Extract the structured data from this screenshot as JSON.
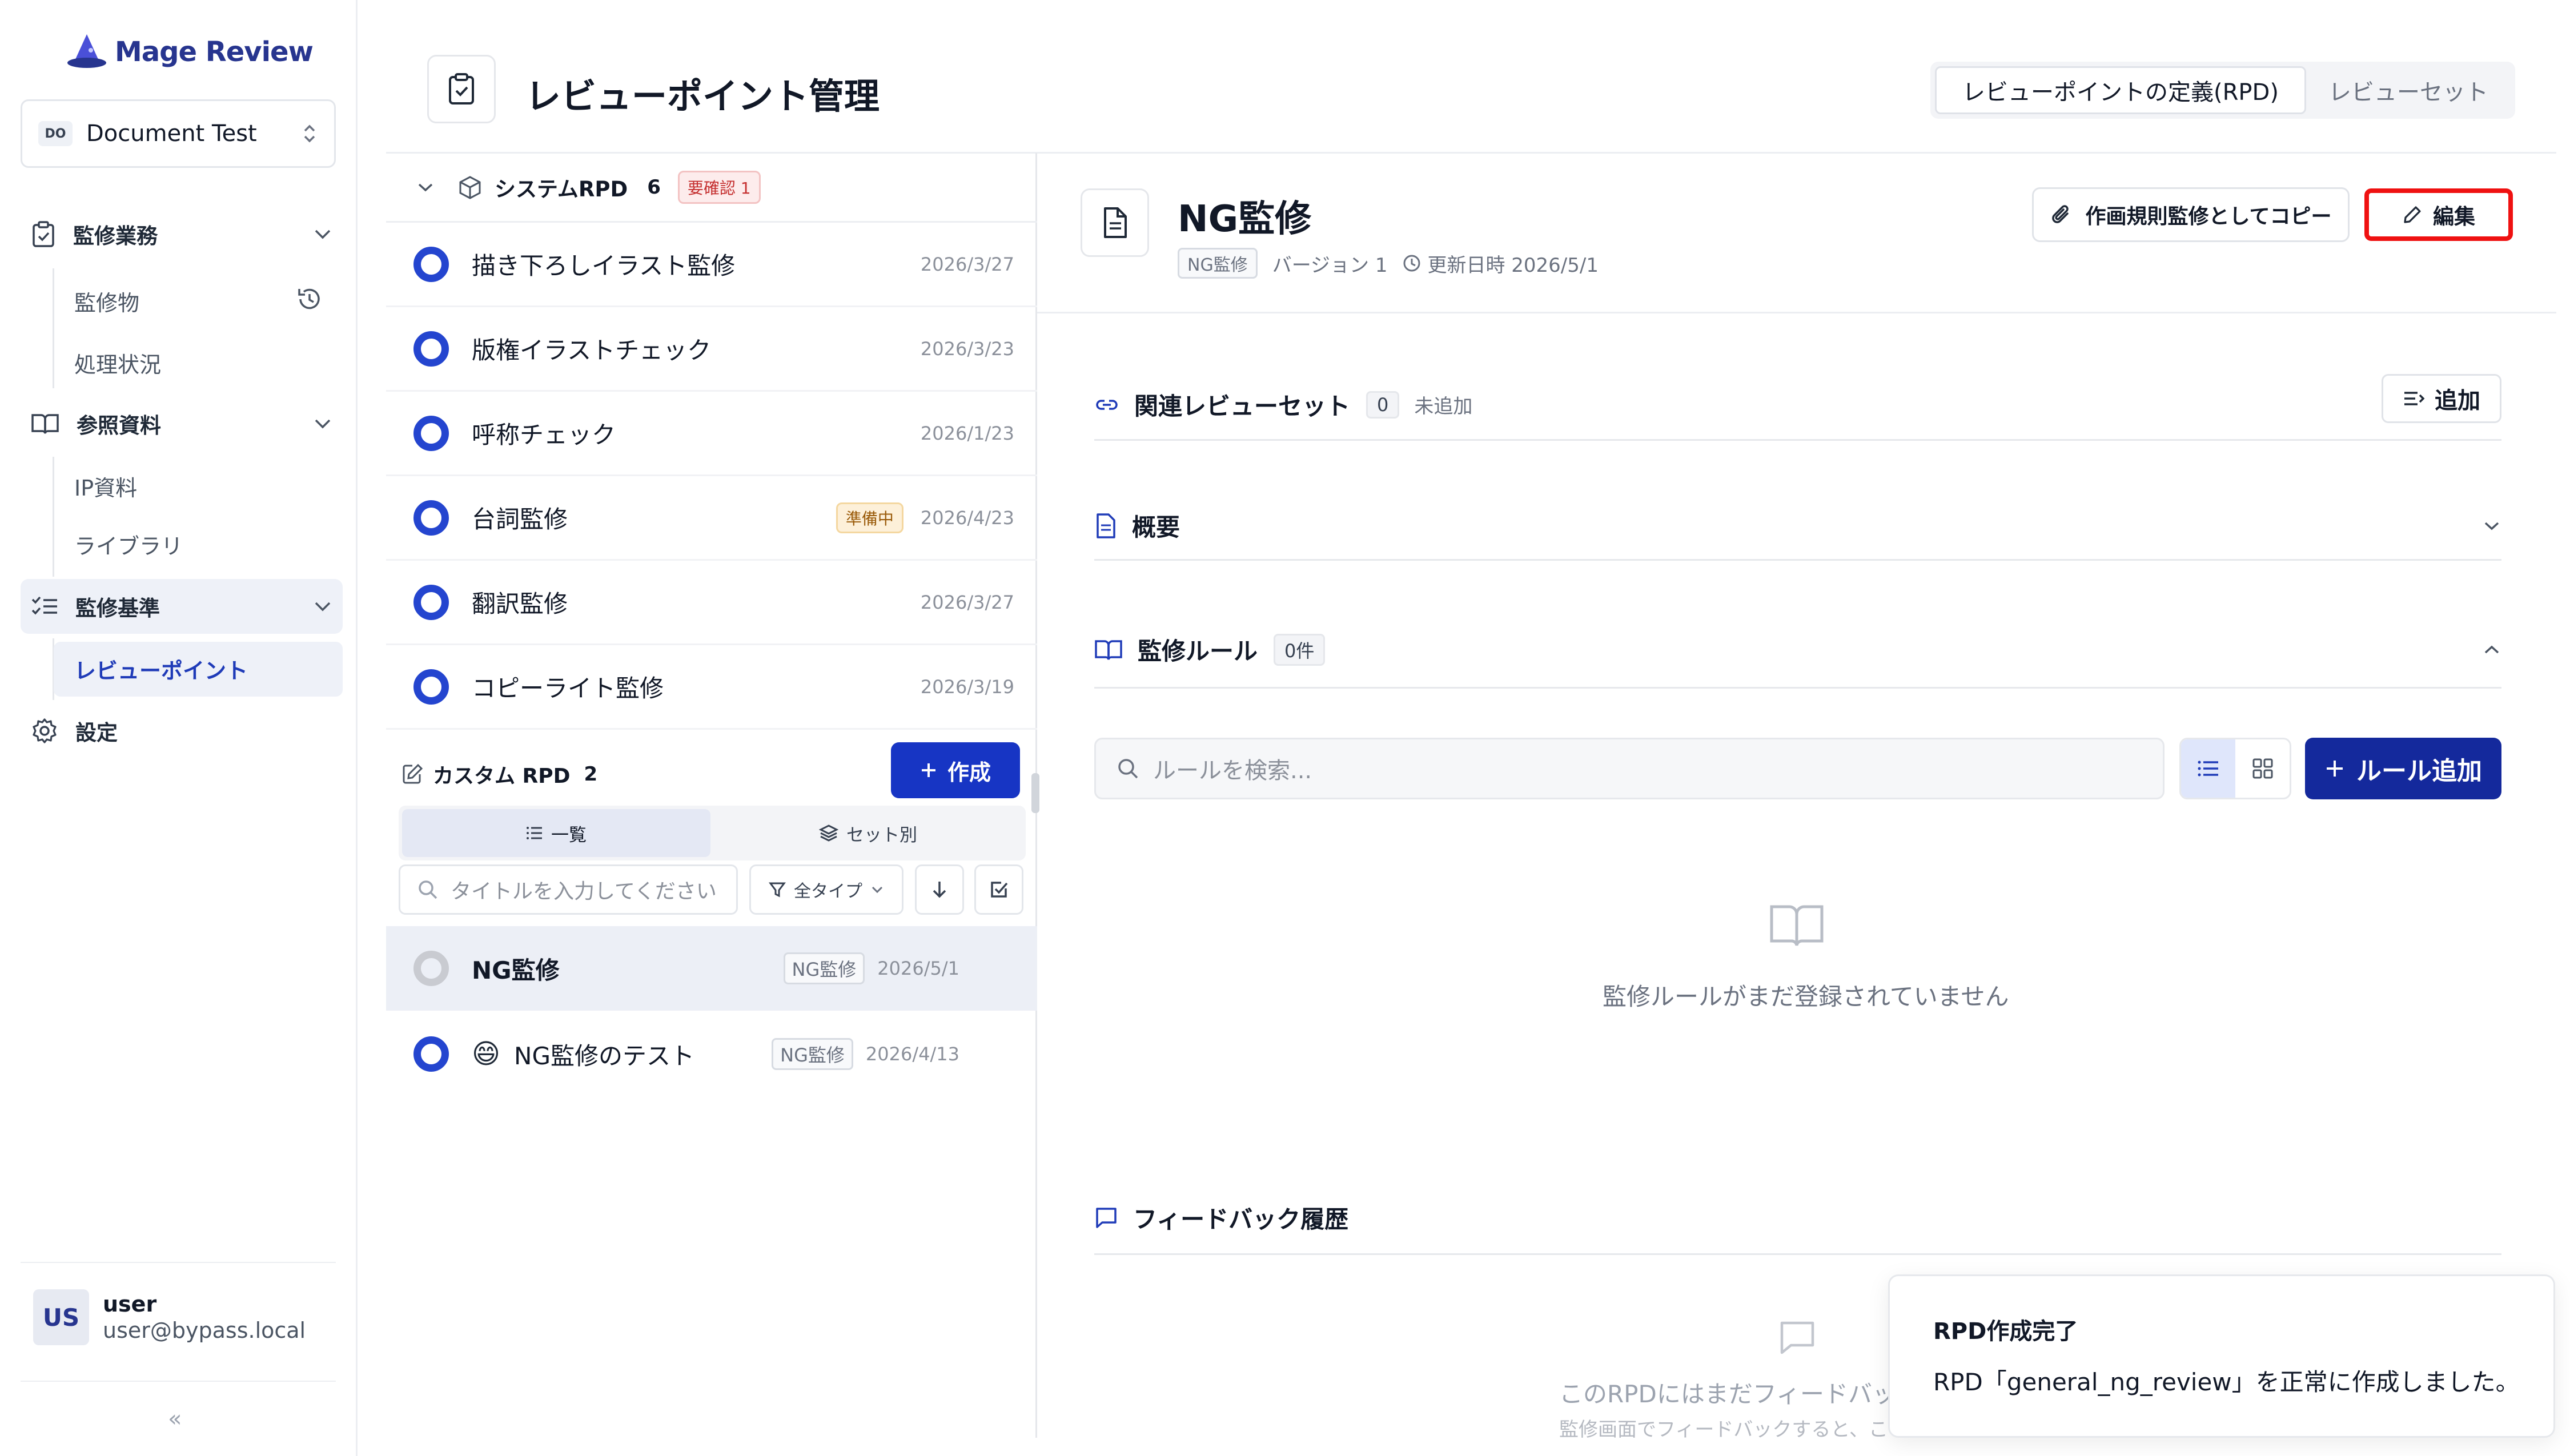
{
  "app": {
    "name": "Mage Review"
  },
  "workspace": {
    "badge": "DO",
    "name": "Document Test"
  },
  "nav": {
    "inspection": "監修業務",
    "inspection_items": [
      "監修物",
      "処理状況"
    ],
    "reference": "参照資料",
    "reference_items": [
      "IP資料",
      "ライブラリ"
    ],
    "standards": "監修基準",
    "standards_items": [
      "レビューポイント"
    ],
    "settings": "設定"
  },
  "user": {
    "avatar": "US",
    "name": "user",
    "email": "user@bypass.local"
  },
  "header": {
    "title": "レビューポイント管理",
    "tab_rpd": "レビューポイントの定義(RPD)",
    "tab_set": "レビューセット"
  },
  "system_rpd": {
    "label": "システムRPD",
    "count": "6",
    "badge": "要確認 1",
    "items": [
      {
        "title": "描き下ろしイラスト監修",
        "date": "2026/3/27"
      },
      {
        "title": "版権イラストチェック",
        "date": "2026/3/23"
      },
      {
        "title": "呼称チェック",
        "date": "2026/1/23"
      },
      {
        "title": "台詞監修",
        "badge": "準備中",
        "date": "2026/4/23"
      },
      {
        "title": "翻訳監修",
        "date": "2026/3/27"
      },
      {
        "title": "コピーライト監修",
        "date": "2026/3/19"
      }
    ]
  },
  "custom_rpd": {
    "label": "カスタム RPD",
    "count": "2",
    "create": "作成",
    "tab_list": "一覧",
    "tab_set": "セット別",
    "search_placeholder": "タイトルを入力してください",
    "type_filter": "全タイプ",
    "items": [
      {
        "title": "NG監修",
        "tag": "NG監修",
        "date": "2026/5/1"
      },
      {
        "emoji": "😄",
        "title": "NG監修のテスト",
        "tag": "NG監修",
        "date": "2026/4/13"
      }
    ]
  },
  "detail": {
    "title": "NG監修",
    "tag": "NG監修",
    "version": "バージョン 1",
    "updated": "更新日時 2026/5/1",
    "copy_button": "作画規則監修としてコピー",
    "edit_button": "編集",
    "related_sets": "関連レビューセット",
    "related_count": "0",
    "related_status": "未追加",
    "add_button": "追加",
    "overview": "概要",
    "rules": "監修ルール",
    "rules_count": "0件",
    "rule_search_placeholder": "ルールを検索...",
    "rule_add": "ルール追加",
    "rules_empty": "監修ルールがまだ登録されていません",
    "feedback": "フィードバック履歴",
    "feedback_empty": "このRPDにはまだフィードバック",
    "feedback_hint": "監修画面でフィードバックすると、ここ"
  },
  "toast": {
    "title": "RPD作成完了",
    "message": "RPD「general_ng_review」を正常に作成しました。"
  },
  "colors": {
    "brand": "#27358f",
    "primary": "#1735c4",
    "highlight": "#ef1111"
  }
}
